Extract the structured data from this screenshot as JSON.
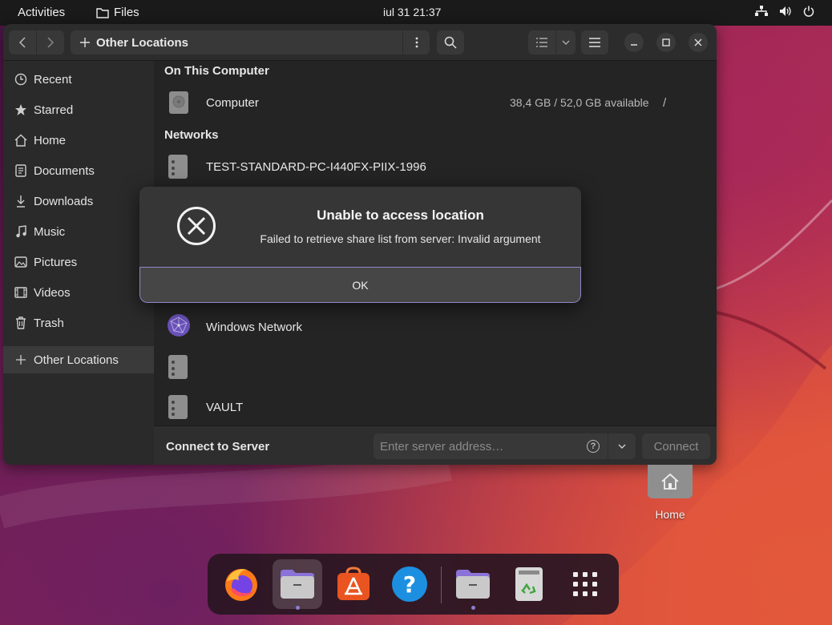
{
  "topbar": {
    "activities": "Activities",
    "app_name": "Files",
    "clock": "iul 31  21:37"
  },
  "window": {
    "path_label": "Other Locations"
  },
  "sidebar": {
    "items": [
      {
        "label": "Recent",
        "icon": "clock-icon"
      },
      {
        "label": "Starred",
        "icon": "star-icon"
      },
      {
        "label": "Home",
        "icon": "home-icon"
      },
      {
        "label": "Documents",
        "icon": "document-icon"
      },
      {
        "label": "Downloads",
        "icon": "download-icon"
      },
      {
        "label": "Music",
        "icon": "music-icon"
      },
      {
        "label": "Pictures",
        "icon": "picture-icon"
      },
      {
        "label": "Videos",
        "icon": "video-icon"
      },
      {
        "label": "Trash",
        "icon": "trash-icon"
      }
    ],
    "other_locations": "Other Locations"
  },
  "content": {
    "on_this_computer": "On This Computer",
    "computer": {
      "label": "Computer",
      "info": "38,4 GB / 52,0 GB available",
      "mount": "/"
    },
    "networks": "Networks",
    "network_rows": [
      {
        "label": "TEST-STANDARD-PC-I440FX-PIIX-1996"
      },
      {
        "label": "Windows Network"
      },
      {
        "label": ""
      },
      {
        "label": "VAULT"
      }
    ]
  },
  "connect": {
    "label": "Connect to Server",
    "placeholder": "Enter server address…",
    "help": "?",
    "button": "Connect"
  },
  "dialog": {
    "title": "Unable to access location",
    "message": "Failed to retrieve share list from server: Invalid argument",
    "ok": "OK"
  },
  "desktop": {
    "home_label": "Home"
  },
  "dock": {
    "items": [
      "firefox-icon",
      "files-icon",
      "app-center-icon",
      "help-icon",
      "files-icon",
      "trash-icon",
      "show-apps-icon"
    ]
  },
  "colors": {
    "accent": "#8f86c8",
    "window_bg": "#242424",
    "topbar_bg": "#1a1a1a"
  }
}
